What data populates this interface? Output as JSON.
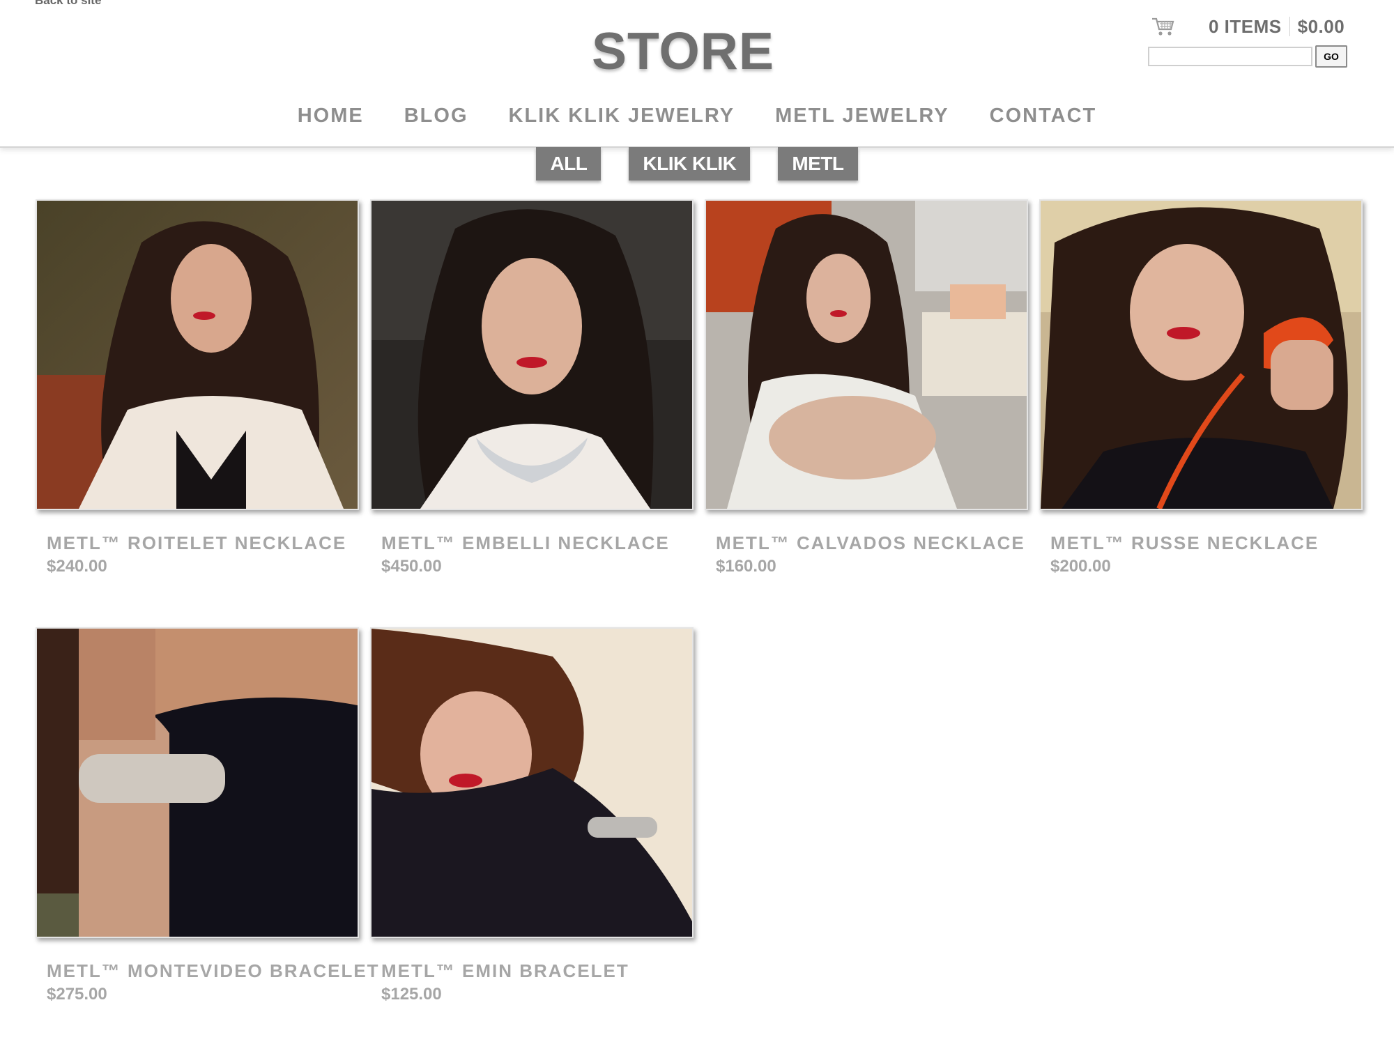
{
  "header": {
    "back_link": "Back to site",
    "title": "STORE",
    "cart": {
      "items": "0 ITEMS",
      "total": "$0.00",
      "icon": "cart-icon"
    },
    "search": {
      "value": "",
      "placeholder": "",
      "button": "GO"
    }
  },
  "nav": [
    "HOME",
    "BLOG",
    "KLIK KLIK JEWELRY",
    "METL JEWELRY",
    "CONTACT"
  ],
  "filters": [
    "ALL",
    "KLIK KLIK",
    "METL"
  ],
  "products": [
    {
      "name": "METL™ ROITELET NECKLACE",
      "price": "$240.00"
    },
    {
      "name": "METL™ EMBELLI NECKLACE",
      "price": "$450.00"
    },
    {
      "name": "METL™ CALVADOS NECKLACE",
      "price": "$160.00"
    },
    {
      "name": "METL™ RUSSE NECKLACE",
      "price": "$200.00"
    },
    {
      "name": "METL™ MONTEVIDEO BRACELET",
      "price": "$275.00"
    },
    {
      "name": "METL™ EMIN BRACELET",
      "price": "$125.00"
    }
  ]
}
